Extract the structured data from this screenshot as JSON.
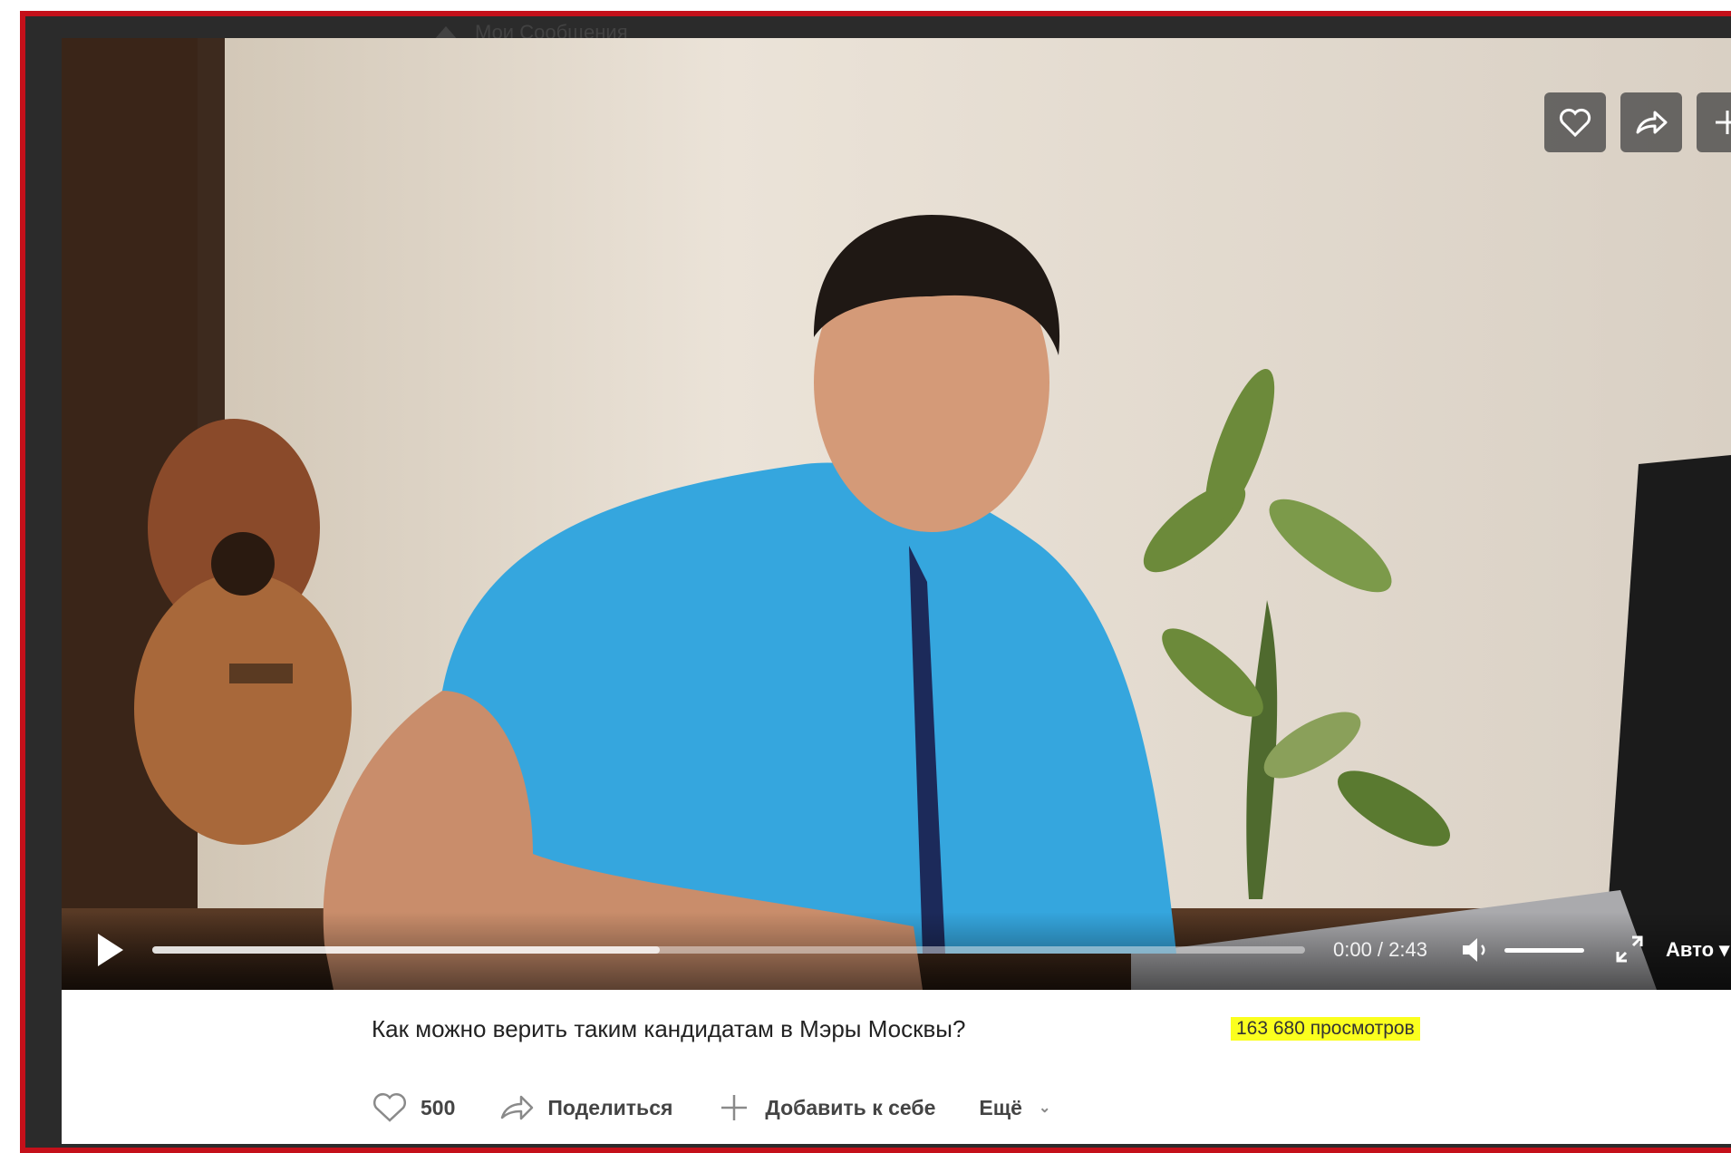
{
  "header": {
    "ghost_text": "Мои Сообщения"
  },
  "player": {
    "overlay_actions": [
      {
        "icon": "heart-icon"
      },
      {
        "icon": "share-icon"
      },
      {
        "icon": "plus-icon"
      }
    ],
    "controls": {
      "progress_buffered": 0.44,
      "time": "0:00 / 2:43",
      "volume_level": 1.0,
      "quality": "Авто"
    }
  },
  "info": {
    "title": "Как можно верить таким кандидатам в Мэры Москвы?",
    "views": "163 680 просмотров",
    "actions": {
      "likes": "500",
      "share": "Поделиться",
      "add": "Добавить к себе",
      "more": "Ещё"
    }
  },
  "colors": {
    "frame_border": "#c4101a",
    "highlight": "#fbff1e",
    "shirt": "#35a6de"
  }
}
